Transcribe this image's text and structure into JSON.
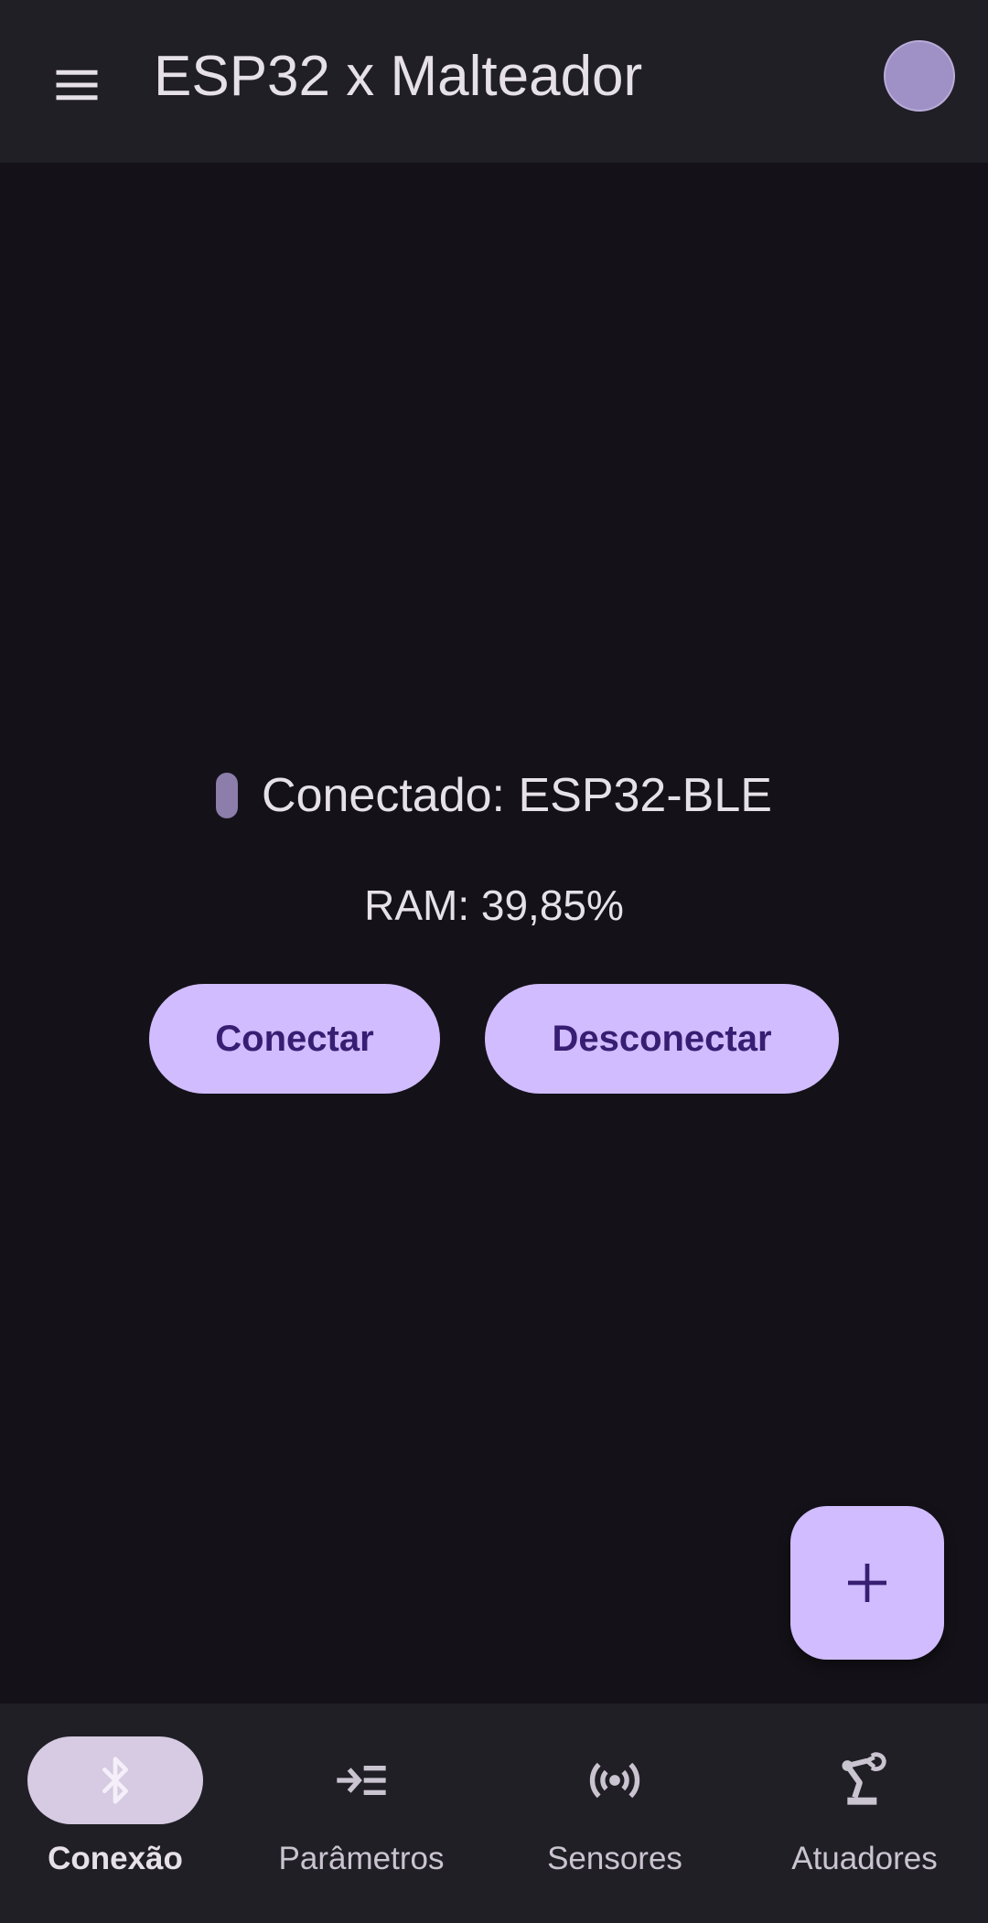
{
  "app_bar": {
    "title": "ESP32 x Malteador",
    "menu_icon": "menu-icon",
    "avatar_color": "#9f90c6"
  },
  "connection": {
    "status_text": "Conectado: ESP32-BLE",
    "status_indicator_color": "#8c7dab",
    "ram_text": "RAM: 39,85%",
    "connect_label": "Conectar",
    "disconnect_label": "Desconectar"
  },
  "fab": {
    "icon": "add-icon"
  },
  "bottom_nav": {
    "items": [
      {
        "label": "Conexão",
        "icon": "bluetooth-icon",
        "active": true
      },
      {
        "label": "Parâmetros",
        "icon": "input-list-icon",
        "active": false
      },
      {
        "label": "Sensores",
        "icon": "sensors-icon",
        "active": false
      },
      {
        "label": "Atuadores",
        "icon": "robot-arm-icon",
        "active": false
      }
    ]
  },
  "colors": {
    "background": "#141218",
    "surface": "#211f26",
    "primary_container": "#d0bcff",
    "on_primary_container": "#381e72",
    "text": "#e6e0e9"
  }
}
